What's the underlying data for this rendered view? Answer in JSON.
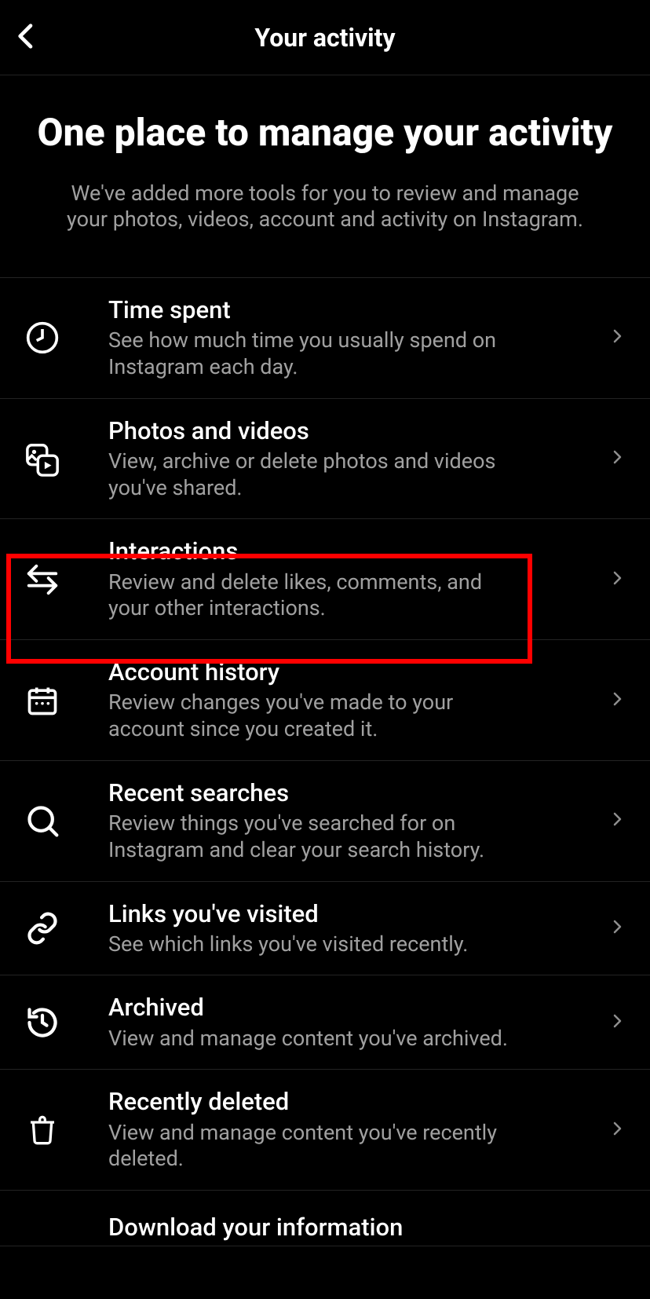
{
  "header": {
    "title": "Your activity"
  },
  "intro": {
    "heading": "One place to manage your activity",
    "sub": "We've added more tools for you to review and manage your photos, videos, account and activity on Instagram."
  },
  "items": [
    {
      "title": "Time spent",
      "desc": "See how much time you usually spend on Instagram each day."
    },
    {
      "title": "Photos and videos",
      "desc": "View, archive or delete photos and videos you've shared."
    },
    {
      "title": "Interactions",
      "desc": "Review and delete likes, comments, and your other interactions."
    },
    {
      "title": "Account history",
      "desc": "Review changes you've made to your account since you created it."
    },
    {
      "title": "Recent searches",
      "desc": "Review things you've searched for on Instagram and clear your search history."
    },
    {
      "title": "Links you've visited",
      "desc": "See which links you've visited recently."
    },
    {
      "title": "Archived",
      "desc": "View and manage content you've archived."
    },
    {
      "title": "Recently deleted",
      "desc": "View and manage content you've recently deleted."
    },
    {
      "title": "Download your information",
      "desc": ""
    }
  ]
}
